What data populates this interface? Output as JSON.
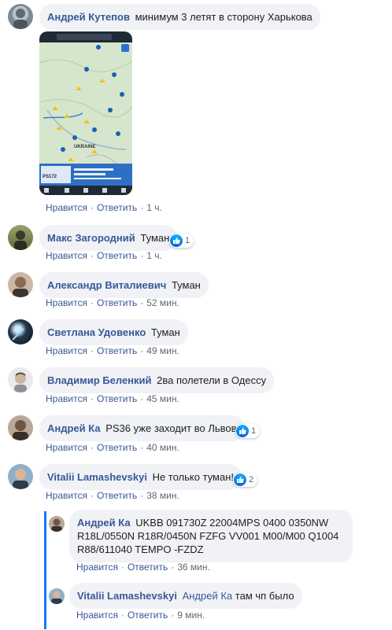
{
  "comments": [
    {
      "author": "Андрей Кутепов",
      "text": "минимум 3 летят в сторону Харькова",
      "like": "Нравится",
      "reply": "Ответить",
      "time": "1 ч.",
      "reactions": ""
    },
    {
      "author": "Макс Загородний",
      "text": "Туман",
      "like": "Нравится",
      "reply": "Ответить",
      "time": "1 ч.",
      "reactions": "1"
    },
    {
      "author": "Александр Виталиевич",
      "text": "Туман",
      "like": "Нравится",
      "reply": "Ответить",
      "time": "52 мин.",
      "reactions": ""
    },
    {
      "author": "Светлана Удовенко",
      "text": "Туман",
      "like": "Нравится",
      "reply": "Ответить",
      "time": "49 мин.",
      "reactions": ""
    },
    {
      "author": "Владимир Беленкий",
      "text": "2ва полетели в Одессу",
      "like": "Нравится",
      "reply": "Ответить",
      "time": "45 мин.",
      "reactions": ""
    },
    {
      "author": "Андрей Ка",
      "text": "PS36 уже заходит во Львов",
      "like": "Нравится",
      "reply": "Ответить",
      "time": "40 мин.",
      "reactions": "1"
    },
    {
      "author": "Vitalii Lamashevskyi",
      "text": "Не только туман!",
      "like": "Нравится",
      "reply": "Ответить",
      "time": "38 мин.",
      "reactions": "2"
    }
  ],
  "replies": [
    {
      "author": "Андрей Ка",
      "text": "UKBB 091730Z 22004MPS 0400 0350NW R18L/0550N R18R/0450N FZFG VV001 M00/M00 Q1004 R88/611040 TEMPO -FZDZ",
      "like": "Нравится",
      "reply": "Ответить",
      "time": "36 мин."
    },
    {
      "author": "Vitalii Lamashevskyi",
      "mention": "Андрей Ка",
      "text": "там чп было",
      "like": "Нравится",
      "reply": "Ответить",
      "time": "9 мин."
    }
  ],
  "map": {
    "app": "flightradar24",
    "region_labels": [
      "UKRAINE",
      "KYIV",
      "BRYANSK"
    ],
    "flight": {
      "callsign": "PS172"
    }
  },
  "colors": {
    "link": "#385898",
    "bubble": "#f0f2f5",
    "thread": "#1877f2"
  }
}
